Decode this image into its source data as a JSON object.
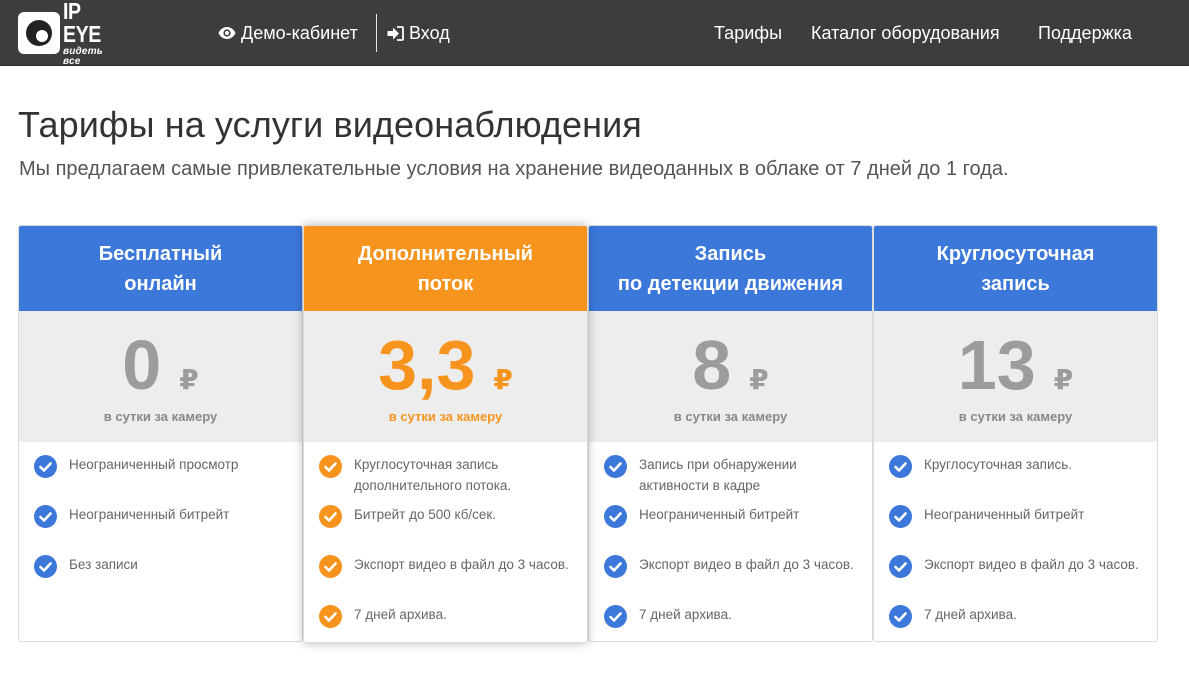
{
  "brand": {
    "logo_title": "IP EYE",
    "logo_tagline": "видеть все"
  },
  "nav": {
    "demo_label": "Демо-кабинет",
    "demo_icon": "eye-icon",
    "login_label": "Вход",
    "login_icon": "sign-in-icon",
    "tariffs_label": "Тарифы",
    "catalog_label": "Каталог оборудования",
    "support_label": "Поддержка"
  },
  "page": {
    "title": "Тарифы на услуги видеонаблюдения",
    "subtitle": "Мы предлагаем самые привлекательные условия на хранение видеоданных в облаке от 7 дней до 1 года."
  },
  "colors": {
    "blue": "#3b78da",
    "orange": "#f7941d",
    "navbar": "#3d3d3d"
  },
  "plans": [
    {
      "title_line1": "Бесплатный",
      "title_line2": "онлайн",
      "price": "0",
      "currency": "₽",
      "period": "в сутки за камеру",
      "features": [
        "Неограниченный просмотр",
        "Неограниченный битрейт",
        "Без записи"
      ]
    },
    {
      "title_line1": "Дополнительный",
      "title_line2": "поток",
      "price": "3,3",
      "currency": "₽",
      "period": "в сутки за камеру",
      "features": [
        "Круглосуточная запись дополнительного потока.",
        "Битрейт до 500 кб/сек.",
        "Экспорт видео в файл до 3 часов.",
        "7 дней архива."
      ]
    },
    {
      "title_line1": "Запись",
      "title_line2": "по детекции движения",
      "price": "8",
      "currency": "₽",
      "period": "в сутки за камеру",
      "features": [
        "Запись при обнаружении активности в кадре",
        "Неограниченный битрейт",
        "Экспорт видео в файл до 3 часов.",
        "7 дней архива."
      ]
    },
    {
      "title_line1": "Круглосуточная",
      "title_line2": "запись",
      "price": "13",
      "currency": "₽",
      "period": "в сутки за камеру",
      "features": [
        "Круглосуточная запись.",
        "Неограниченный битрейт",
        "Экспорт видео в файл до 3 часов.",
        "7 дней архива."
      ]
    }
  ]
}
